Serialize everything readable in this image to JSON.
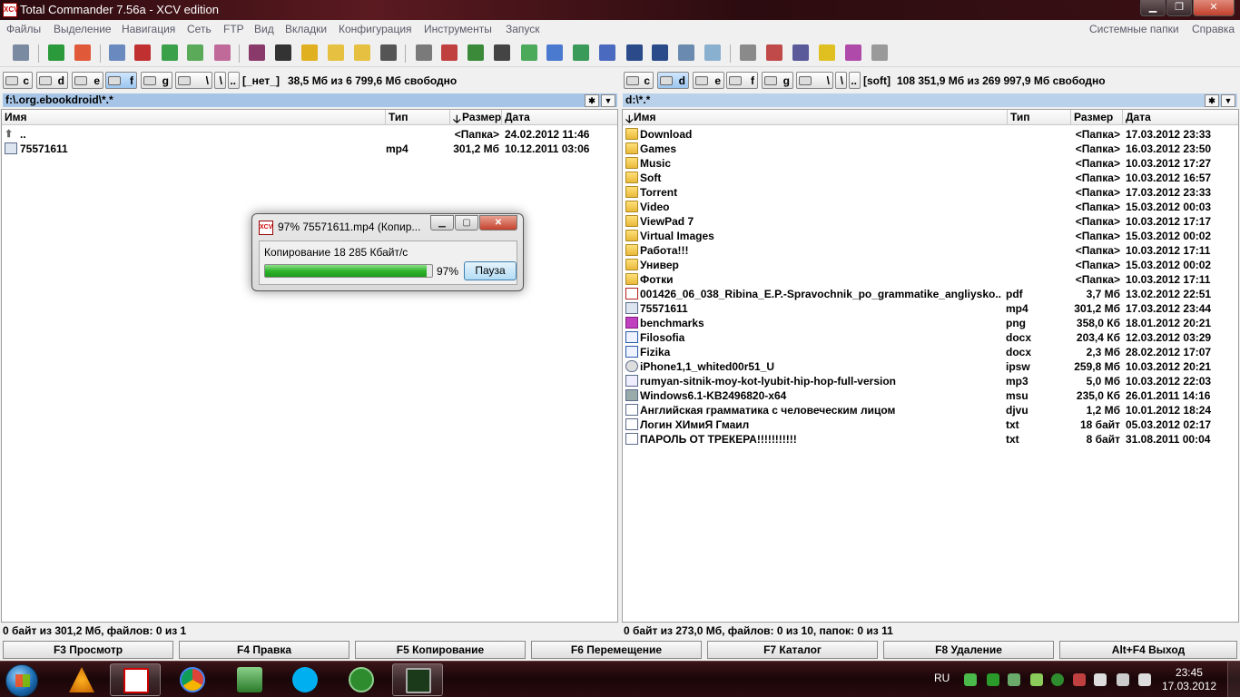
{
  "window": {
    "title": "Total Commander 7.56a - XCV edition",
    "app_icon": "XCV",
    "controls": [
      "minimize-icon",
      "maximize-icon",
      "close-icon"
    ]
  },
  "menu": {
    "items": [
      "Файлы",
      "Выделение",
      "Навигация",
      "Сеть",
      "FTP",
      "Вид",
      "Вкладки",
      "Конфигурация",
      "Инструменты",
      "Запуск"
    ],
    "right_items": [
      "Системные папки",
      "Справка"
    ]
  },
  "left": {
    "drives": [
      "c",
      "d",
      "e",
      "f",
      "g",
      "\\",
      ".."
    ],
    "active_drive": "f",
    "combo": "[_нет_]",
    "free_info": "38,5 Мб из 6 799,6 Мб свободно",
    "path": "f:\\.org.ebookdroid\\*.*",
    "columns": {
      "name": "Имя",
      "type": "Тип",
      "size": "Размер",
      "date": "Дата"
    },
    "rows": [
      {
        "name": "..",
        "type": "",
        "size": "<Папка>",
        "date": "24.02.2012 11:46",
        "icon": "up-dir-icon"
      },
      {
        "name": "75571611",
        "type": "mp4",
        "size": "301,2 Мб",
        "date": "10.12.2011 03:06",
        "icon": "media-file-icon"
      }
    ],
    "status": "0 байт из 301,2 Мб, файлов: 0 из 1"
  },
  "right": {
    "drives": [
      "c",
      "d",
      "e",
      "f",
      "g",
      "\\",
      ".."
    ],
    "active_drive": "d",
    "combo": "[soft]",
    "free_info": "108 351,9 Мб из 269 997,9 Мб свободно",
    "path": "d:\\*.*",
    "columns": {
      "name": "Имя",
      "type": "Тип",
      "size": "Размер",
      "date": "Дата"
    },
    "rows": [
      {
        "name": "Download",
        "type": "",
        "size": "<Папка>",
        "date": "17.03.2012 23:33",
        "icon": "folder"
      },
      {
        "name": "Games",
        "type": "",
        "size": "<Папка>",
        "date": "16.03.2012 23:50",
        "icon": "folder"
      },
      {
        "name": "Music",
        "type": "",
        "size": "<Папка>",
        "date": "10.03.2012 17:27",
        "icon": "folder"
      },
      {
        "name": "Soft",
        "type": "",
        "size": "<Папка>",
        "date": "10.03.2012 16:57",
        "icon": "folder"
      },
      {
        "name": "Torrent",
        "type": "",
        "size": "<Папка>",
        "date": "17.03.2012 23:33",
        "icon": "folder"
      },
      {
        "name": "Video",
        "type": "",
        "size": "<Папка>",
        "date": "15.03.2012 00:03",
        "icon": "folder"
      },
      {
        "name": "ViewPad 7",
        "type": "",
        "size": "<Папка>",
        "date": "10.03.2012 17:17",
        "icon": "folder"
      },
      {
        "name": "Virtual Images",
        "type": "",
        "size": "<Папка>",
        "date": "15.03.2012 00:02",
        "icon": "folder"
      },
      {
        "name": "Работа!!!",
        "type": "",
        "size": "<Папка>",
        "date": "10.03.2012 17:11",
        "icon": "folder"
      },
      {
        "name": "Универ",
        "type": "",
        "size": "<Папка>",
        "date": "15.03.2012 00:02",
        "icon": "folder"
      },
      {
        "name": "Фотки",
        "type": "",
        "size": "<Папка>",
        "date": "10.03.2012 17:11",
        "icon": "folder"
      },
      {
        "name": "001426_06_038_Ribina_E.P.-Spravochnik_po_grammatike_angliysko..",
        "type": "pdf",
        "size": "3,7 Мб",
        "date": "13.02.2012 22:51",
        "icon": "pdf"
      },
      {
        "name": "75571611",
        "type": "mp4",
        "size": "301,2 Мб",
        "date": "17.03.2012 23:44",
        "icon": "media"
      },
      {
        "name": "benchmarks",
        "type": "png",
        "size": "358,0 Кб",
        "date": "18.01.2012 20:21",
        "icon": "png"
      },
      {
        "name": "Filosofia",
        "type": "docx",
        "size": "203,4 Кб",
        "date": "12.03.2012 03:29",
        "icon": "word"
      },
      {
        "name": "Fizika",
        "type": "docx",
        "size": "2,3 Мб",
        "date": "28.02.2012 17:07",
        "icon": "word"
      },
      {
        "name": "iPhone1,1_whited00r51_U",
        "type": "ipsw",
        "size": "259,8 Мб",
        "date": "10.03.2012 20:21",
        "icon": "ipsw"
      },
      {
        "name": "rumyan-sitnik-moy-kot-lyubit-hip-hop-full-version",
        "type": "mp3",
        "size": "5,0 Мб",
        "date": "10.03.2012 22:03",
        "icon": "mp3"
      },
      {
        "name": "Windows6.1-KB2496820-x64",
        "type": "msu",
        "size": "235,0 Кб",
        "date": "26.01.2011 14:16",
        "icon": "msu"
      },
      {
        "name": "Английская грамматика с человеческим лицом",
        "type": "djvu",
        "size": "1,2 Мб",
        "date": "10.01.2012 18:24",
        "icon": "doc"
      },
      {
        "name": "Логин ХИмиЯ Гмаил",
        "type": "txt",
        "size": "18 байт",
        "date": "05.03.2012 02:17",
        "icon": "doc"
      },
      {
        "name": "ПАРОЛЬ ОТ ТРЕКЕРА!!!!!!!!!!!",
        "type": "txt",
        "size": "8 байт",
        "date": "31.08.2011 00:04",
        "icon": "doc"
      }
    ],
    "status": "0 байт из 273,0 Мб, файлов: 0 из 10, папок: 0 из 11"
  },
  "fkeys": [
    "F3 Просмотр",
    "F4 Правка",
    "F5 Копирование",
    "F6 Перемещение",
    "F7 Каталог",
    "F8 Удаление",
    "Alt+F4 Выход"
  ],
  "dialog": {
    "title": "97% 75571611.mp4 (Копир...",
    "status": "Копирование 18 285 Кбайт/с",
    "progress_percent": 97,
    "progress_label": "97%",
    "pause_label": "Пауза"
  },
  "taskbar": {
    "apps": [
      "start-orb",
      "aimp-icon",
      "total-commander-icon",
      "chrome-icon",
      "winrar-icon",
      "skype-icon",
      "utorrent-icon",
      "task-manager-icon"
    ],
    "lang": "RU",
    "time": "23:45",
    "date": "17.03.2012"
  }
}
